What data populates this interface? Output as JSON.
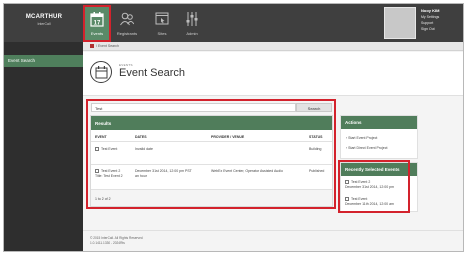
{
  "brand": {
    "name": "MCARTHUR",
    "subtitle": "InterCall"
  },
  "nav": [
    {
      "label": "Events",
      "icon": "calendar-icon",
      "day": "17"
    },
    {
      "label": "Registrants",
      "icon": "users-icon"
    },
    {
      "label": "Sites",
      "icon": "browser-icon"
    },
    {
      "label": "Admin",
      "icon": "sliders-icon"
    }
  ],
  "user": {
    "name": "Nooy KIM",
    "menu": [
      "My Settings",
      "Support",
      "Sign Out"
    ]
  },
  "sidebar": {
    "items": [
      {
        "label": "Event Search"
      }
    ]
  },
  "breadcrumb": {
    "text": "/ Event Search"
  },
  "page": {
    "pre": "EVENTS",
    "title": "Event Search"
  },
  "search": {
    "value": "Test",
    "button": "Search"
  },
  "results": {
    "title": "Results",
    "columns": [
      "EVENT",
      "DATES",
      "PROVIDER / VENUE",
      "STATUS"
    ],
    "rows": [
      {
        "event": "Test Event",
        "event_sub": "",
        "dates": "Invalid date",
        "dates_sub": "",
        "provider": "",
        "status": "Building"
      },
      {
        "event": "Test Event 2",
        "event_sub": "Title: Test Event 2",
        "dates": "December 31st 2014, 12:00 pm PST",
        "dates_sub": "an hour",
        "provider": "WebEx Event Center, Operator Assisted Audio",
        "status": "Published"
      }
    ],
    "count": "1 to 2 of 2"
  },
  "actions": {
    "title": "Actions",
    "items": [
      "Start Event Project",
      "Start Direct Event Project"
    ]
  },
  "recent": {
    "title": "Recently Selected Events",
    "items": [
      {
        "name": "Test Event 2",
        "date": "December 31st 2014, 12:00 pm"
      },
      {
        "name": "Test Event",
        "date": "December 11th 2014, 12:00 am"
      }
    ]
  },
  "footer": {
    "copyright": "© 2015 InterCall. All Rights Reserved",
    "version": "1.0.1411.1330 - 2024Rts"
  },
  "colors": {
    "accent": "#507d5b",
    "highlight": "#d3222c",
    "topbar": "#3f3f3f",
    "sidebar": "#2e2e2e"
  }
}
